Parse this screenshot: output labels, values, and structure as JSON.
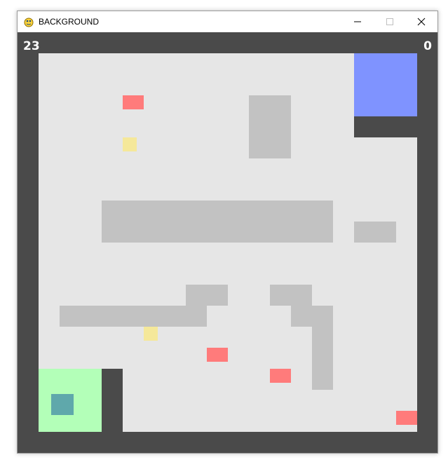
{
  "window": {
    "title": "BACKGROUND",
    "controls": [
      "minimize-icon",
      "maximize-icon",
      "close-icon"
    ]
  },
  "hud": {
    "score_left": "23",
    "score_right": "0"
  },
  "colors": {
    "wall": "#4a4a4a",
    "floor": "#e6e6e6",
    "obstacle": "#c2c2c2",
    "goal": "#7f93ff",
    "start_zone": "#b3ffb8",
    "player": "#5fa8ab",
    "enemy": "#ff7b7b",
    "coin": "#f5e89a"
  },
  "legend": [
    "goal",
    "start-zone",
    "player",
    "enemy",
    "coin",
    "obstacle",
    "wall"
  ]
}
